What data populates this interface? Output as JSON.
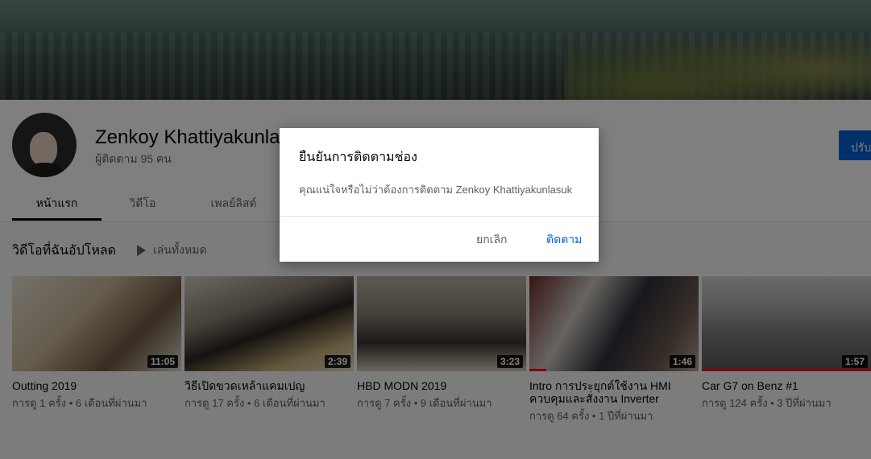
{
  "channel": {
    "name": "Zenkoy Khattiyakunlasuk",
    "subscribers": "ผู้ติดตาม 95 คน",
    "customize_label": "ปรับแต่ง"
  },
  "tabs": [
    {
      "label": "หน้าแรก",
      "active": true
    },
    {
      "label": "วิดีโอ",
      "active": false
    },
    {
      "label": "เพลย์ลิสต์",
      "active": false
    }
  ],
  "section": {
    "title": "วิดีโอที่ฉันอัปโหลด",
    "play_all": "เล่นทั้งหมด"
  },
  "videos": [
    {
      "title": "Outting 2019",
      "duration": "11:05",
      "meta": "การดู 1 ครั้ง • 6 เดือนที่ผ่านมา",
      "watched": 0
    },
    {
      "title": "วิธีเปิดขวดเหล้าแคมเปญ",
      "duration": "2:39",
      "meta": "การดู 17 ครั้ง • 6 เดือนที่ผ่านมา",
      "watched": 0
    },
    {
      "title": "HBD MODN 2019",
      "duration": "3:23",
      "meta": "การดู 7 ครั้ง • 9 เดือนที่ผ่านมา",
      "watched": 0
    },
    {
      "title": "Intro การประยุกต์ใช้งาน HMI ควบคุมและสั่งงาน Inverter",
      "duration": "1:46",
      "meta": "การดู 64 ครั้ง • 1 ปีที่ผ่านมา",
      "watched": 0.1
    },
    {
      "title": "Car G7 on Benz #1",
      "duration": "1:57",
      "meta": "การดู 124 ครั้ง • 3 ปีที่ผ่านมา",
      "watched": 1.0
    }
  ],
  "dialog": {
    "title": "ยืนยันการติดตามช่อง",
    "body": "คุณแน่ใจหรือไม่ว่าต้องการติดตาม Zenkoy Khattiyakunlasuk",
    "cancel_label": "ยกเลิก",
    "confirm_label": "ติดตาม"
  },
  "colors": {
    "accent": "#065fd4",
    "progress": "#ff0000"
  }
}
